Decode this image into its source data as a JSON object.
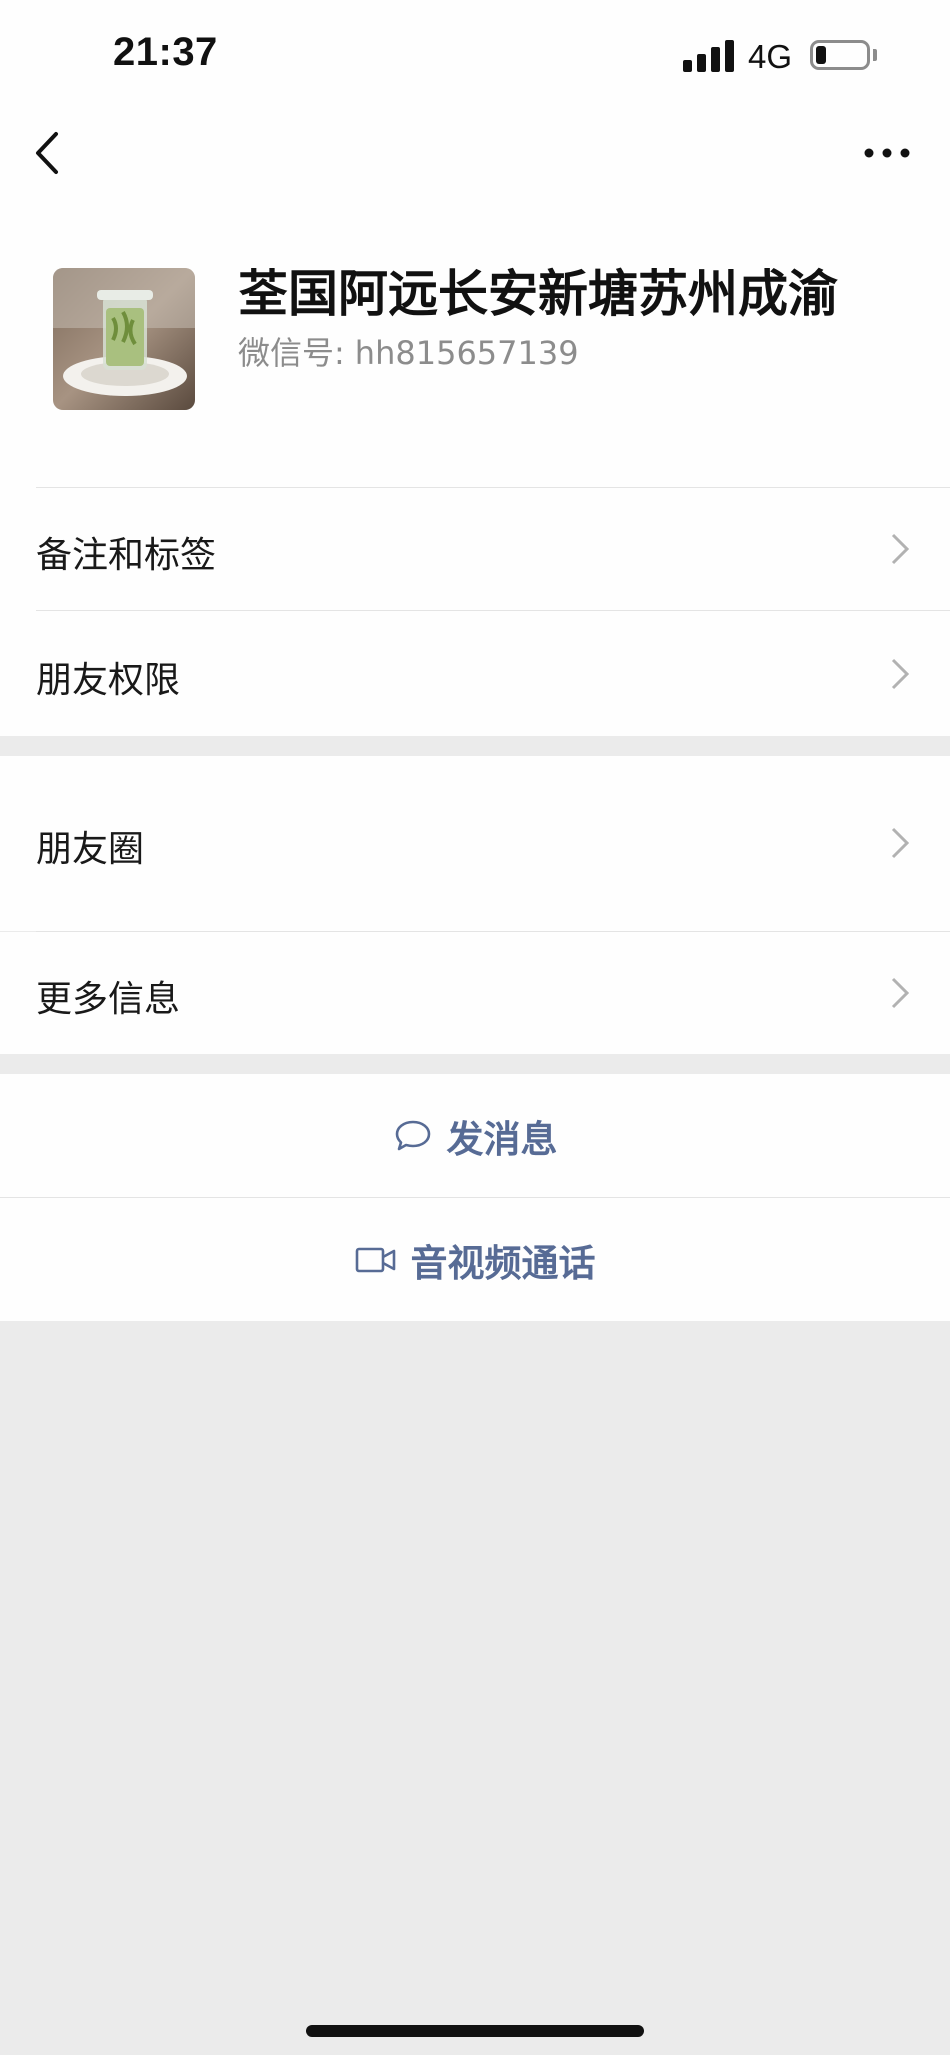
{
  "status_bar": {
    "time": "21:37",
    "network": "4G"
  },
  "nav": {
    "back_icon": "chevron-left-icon",
    "more_icon": "ellipsis-icon"
  },
  "profile": {
    "name": "荃国阿远长安新塘苏州成渝",
    "wechat_id_label": "微信号:",
    "wechat_id": "hh815657139"
  },
  "menu_group_1": [
    {
      "label": "备注和标签"
    },
    {
      "label": "朋友权限"
    }
  ],
  "menu_group_2": [
    {
      "label": "朋友圈"
    },
    {
      "label": "更多信息"
    }
  ],
  "actions": {
    "message_label": "发消息",
    "call_label": "音视频通话"
  },
  "colors": {
    "link_blue": "#576b95",
    "background_gray": "#ebebeb",
    "panel_white": "#fefefe"
  }
}
